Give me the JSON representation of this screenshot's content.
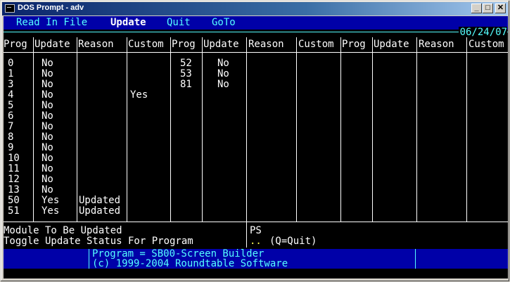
{
  "window": {
    "title": "DOS Prompt - adv"
  },
  "menu": {
    "items": [
      "Read In File",
      "Update",
      "Quit",
      "GoTo"
    ],
    "active": "Update"
  },
  "date": "06/24/07",
  "headers": [
    "Prog",
    "Update",
    "Reason",
    "Custom",
    "Prog",
    "Update",
    "Reason",
    "Custom",
    "Prog",
    "Update",
    "Reason",
    "Custom"
  ],
  "columns": {
    "group1": [
      {
        "prog": "0",
        "update": "No",
        "reason": "",
        "custom": ""
      },
      {
        "prog": "1",
        "update": "No",
        "reason": "",
        "custom": ""
      },
      {
        "prog": "3",
        "update": "No",
        "reason": "",
        "custom": ""
      },
      {
        "prog": "4",
        "update": "No",
        "reason": "",
        "custom": "Yes"
      },
      {
        "prog": "5",
        "update": "No",
        "reason": "",
        "custom": ""
      },
      {
        "prog": "6",
        "update": "No",
        "reason": "",
        "custom": ""
      },
      {
        "prog": "7",
        "update": "No",
        "reason": "",
        "custom": ""
      },
      {
        "prog": "8",
        "update": "No",
        "reason": "",
        "custom": ""
      },
      {
        "prog": "9",
        "update": "No",
        "reason": "",
        "custom": ""
      },
      {
        "prog": "10",
        "update": "No",
        "reason": "",
        "custom": ""
      },
      {
        "prog": "11",
        "update": "No",
        "reason": "",
        "custom": ""
      },
      {
        "prog": "12",
        "update": "No",
        "reason": "",
        "custom": ""
      },
      {
        "prog": "13",
        "update": "No",
        "reason": "",
        "custom": ""
      },
      {
        "prog": "50",
        "update": "Yes",
        "reason": "Updated",
        "custom": ""
      },
      {
        "prog": "51",
        "update": "Yes",
        "reason": "Updated",
        "custom": ""
      }
    ],
    "group2": [
      {
        "prog": "52",
        "update": "No"
      },
      {
        "prog": "53",
        "update": "No"
      },
      {
        "prog": "81",
        "update": "No"
      }
    ]
  },
  "bottom": {
    "module_label": "Module To Be Updated",
    "toggle_label": "Toggle Update Status For Program",
    "module_value": "PS",
    "input_cursor": "..",
    "quit_hint": "(Q=Quit)"
  },
  "status": {
    "line1": "Program = SB00-Screen Builder",
    "line2": "(c) 1999-2004 Roundtable Software"
  },
  "colors": {
    "background": "#000000",
    "menu_bg": "#0000a8",
    "menu_text": "#55ffff",
    "text": "#ffffff"
  }
}
